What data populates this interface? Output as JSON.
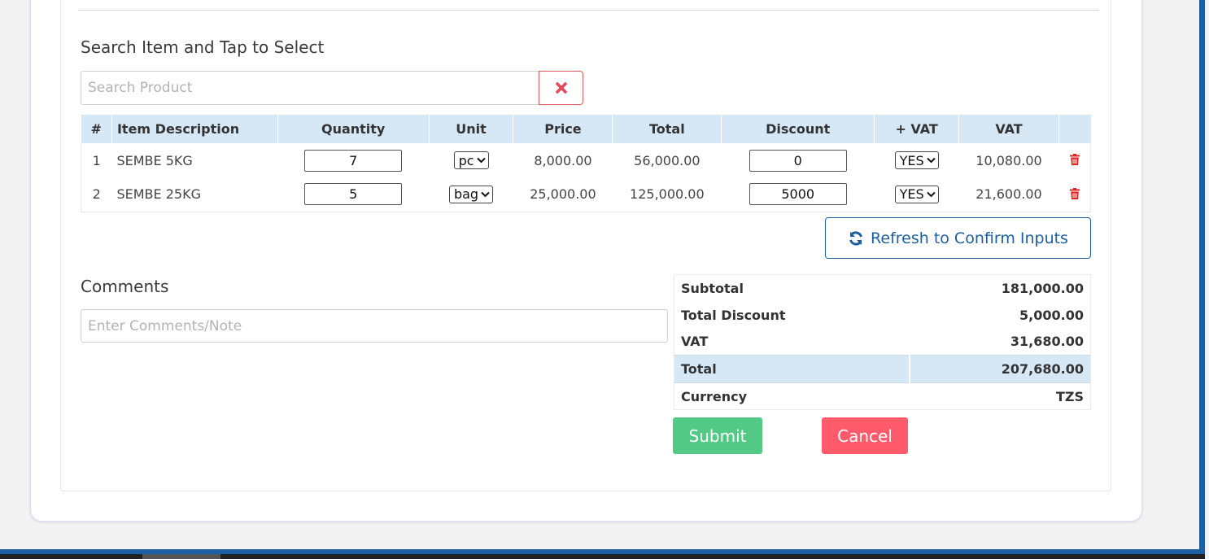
{
  "search": {
    "section_label": "Search Item and Tap to Select",
    "placeholder": "Search Product",
    "clear_icon": "times-icon"
  },
  "items_table": {
    "headers": [
      "#",
      "Item Description",
      "Quantity",
      "Unit",
      "Price",
      "Total",
      "Discount",
      "+ VAT",
      "VAT",
      ""
    ],
    "rows": [
      {
        "index": "1",
        "description": "SEMBE 5KG",
        "quantity": "7",
        "unit": "pc",
        "price": "8,000.00",
        "total": "56,000.00",
        "discount": "0",
        "vat_option": "YES",
        "vat": "10,080.00"
      },
      {
        "index": "2",
        "description": "SEMBE 25KG",
        "quantity": "5",
        "unit": "bag",
        "price": "25,000.00",
        "total": "125,000.00",
        "discount": "5000",
        "vat_option": "YES",
        "vat": "21,600.00"
      }
    ],
    "delete_icon": "trash-icon"
  },
  "refresh_button": {
    "label": "Refresh to Confirm Inputs",
    "icon": "refresh-icon"
  },
  "comments": {
    "section_label": "Comments",
    "placeholder": "Enter Comments/Note"
  },
  "summary": {
    "subtotal_label": "Subtotal",
    "subtotal_value": "181,000.00",
    "discount_label": "Total Discount",
    "discount_value": "5,000.00",
    "vat_label": "VAT",
    "vat_value": "31,680.00",
    "total_label": "Total",
    "total_value": "207,680.00",
    "currency_label": "Currency",
    "currency_value": "TZS"
  },
  "actions": {
    "submit_label": "Submit",
    "cancel_label": "Cancel"
  },
  "colors": {
    "accent_blue": "#1d5f9e",
    "header_bg": "#d6e8f6",
    "submit": "#52c984",
    "cancel": "#ff5b6b",
    "danger_icon": "#e02424"
  }
}
